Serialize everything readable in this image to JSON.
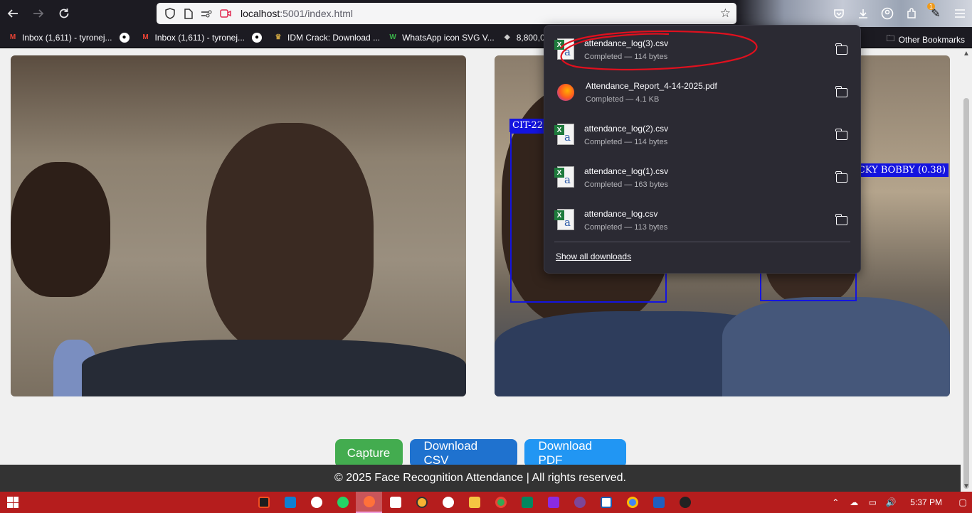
{
  "browser": {
    "url_host": "localhost",
    "url_rest": ":5001/index.html",
    "bookmarks": [
      {
        "label": "Inbox (1,611) - tyronej...",
        "color": "#ea4335",
        "glyph": "M"
      },
      {
        "label": "Inbox (1,611) - tyronej...",
        "color": "#ea4335",
        "glyph": "M"
      },
      {
        "label": "IDM Crack: Download ...",
        "color": "#7a5a20",
        "glyph": "♛"
      },
      {
        "label": "WhatsApp icon SVG V...",
        "color": "#3ab54a",
        "glyph": "W"
      },
      {
        "label": "8,800,0",
        "color": "#444",
        "glyph": "◆"
      }
    ],
    "other_bookmarks": "Other Bookmarks",
    "badge": "1"
  },
  "camera": {
    "left_label_1": "CIT-22",
    "right_label_1": "CKY BOBBY (0.38)"
  },
  "buttons": {
    "capture": "Capture",
    "download_csv": "Download CSV",
    "download_pdf": "Download PDF"
  },
  "footer": {
    "text": "© 2025 Face Recognition Attendance | All rights reserved."
  },
  "downloads": {
    "items": [
      {
        "name": "attendance_log(3).csv",
        "status": "Completed — 114 bytes",
        "type": "csv"
      },
      {
        "name": "Attendance_Report_4-14-2025.pdf",
        "status": "Completed — 4.1 KB",
        "type": "pdf"
      },
      {
        "name": "attendance_log(2).csv",
        "status": "Completed — 114 bytes",
        "type": "csv"
      },
      {
        "name": "attendance_log(1).csv",
        "status": "Completed — 163 bytes",
        "type": "csv"
      },
      {
        "name": "attendance_log.csv",
        "status": "Completed — 113 bytes",
        "type": "csv"
      }
    ],
    "show_all": "Show all downloads"
  },
  "taskbar": {
    "time": "5:37 PM",
    "apps": [
      "figma",
      "vscode",
      "github",
      "whatsapp",
      "firefox",
      "notes",
      "chrome-canary",
      "chatgpt",
      "explorer",
      "chrome",
      "play",
      "video",
      "tor",
      "news",
      "chrome2",
      "terminal",
      "game"
    ]
  }
}
